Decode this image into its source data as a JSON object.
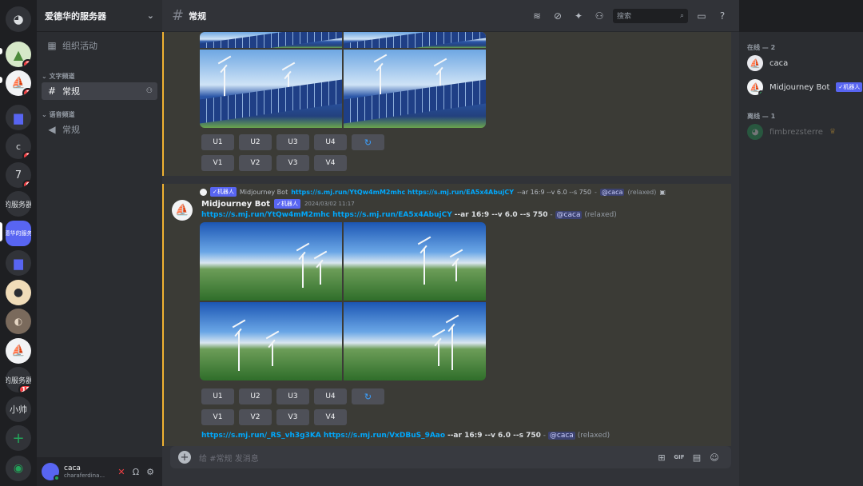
{
  "server": {
    "name": "爱德华的服务器",
    "rail": [
      {
        "label": "",
        "badge": "",
        "kind": "discord"
      },
      {
        "label": "",
        "badge": "2",
        "kind": "avatar"
      },
      {
        "label": "",
        "badge": "1",
        "kind": "avatar"
      },
      {
        "label": "",
        "badge": "",
        "kind": "folder"
      },
      {
        "label": "c",
        "badge": "1",
        "kind": "text"
      },
      {
        "label": "7",
        "badge": "6",
        "kind": "text"
      },
      {
        "label": "的服务器",
        "badge": "",
        "kind": "text"
      },
      {
        "label": "德华的服务",
        "badge": "",
        "kind": "active"
      },
      {
        "label": "",
        "badge": "",
        "kind": "folder"
      },
      {
        "label": "",
        "badge": "",
        "kind": "avatar"
      },
      {
        "label": "",
        "badge": "",
        "kind": "avatar"
      },
      {
        "label": "",
        "badge": "",
        "kind": "avatar"
      },
      {
        "label": "的服务器",
        "badge": "15",
        "kind": "text"
      },
      {
        "label": "小帅",
        "badge": "",
        "kind": "text"
      }
    ]
  },
  "sidebar": {
    "events": "组织活动",
    "text_category": "文字频道",
    "text_channel": "常规",
    "voice_category": "语音频道",
    "voice_channel": "常规"
  },
  "user": {
    "name": "caca",
    "sub": "charaferdina..."
  },
  "header": {
    "channel": "常规",
    "search_placeholder": "搜索"
  },
  "messages": {
    "buttons_row1": [
      "U1",
      "U2",
      "U3",
      "U4"
    ],
    "buttons_row2": [
      "V1",
      "V2",
      "V3",
      "V4"
    ],
    "ref": {
      "bot_name": "Midjourney Bot",
      "bot_tag": "✓机器人",
      "links": "https://s.mj.run/YtQw4mM2mhc https://s.mj.run/EA5x4AbujCY",
      "params": "--ar 16:9 --v 6.0 --s 750",
      "sep": "-",
      "mention": "@caca",
      "status": "(relaxed)"
    },
    "author": "Midjourney Bot",
    "author_tag": "✓机器人",
    "timestamp": "2024/03/02 11:17",
    "content_links": "https://s.mj.run/YtQw4mM2mhc https://s.mj.run/EA5x4AbujCY",
    "content_params": "--ar 16:9 --v 6.0 --s 750",
    "content_sep": "-",
    "content_mention": "@caca",
    "content_status": "(relaxed)",
    "next_links": "https://s.mj.run/_RS_vh3g3KA https://s.mj.run/VxDBuS_9Aao",
    "next_params": "--ar 16:9 --v 6.0 --s 750",
    "next_sep": "-",
    "next_mention": "@caca",
    "next_status": "(relaxed)"
  },
  "composer": {
    "placeholder": "给 #常规 发消息"
  },
  "members": {
    "online_label": "在线 — 2",
    "offline_label": "离线 — 1",
    "online": [
      {
        "name": "caca",
        "tag": ""
      },
      {
        "name": "Midjourney Bot",
        "tag": "✓机器人"
      }
    ],
    "offline": [
      {
        "name": "fimbrezsterre",
        "tag": "♛"
      }
    ]
  }
}
